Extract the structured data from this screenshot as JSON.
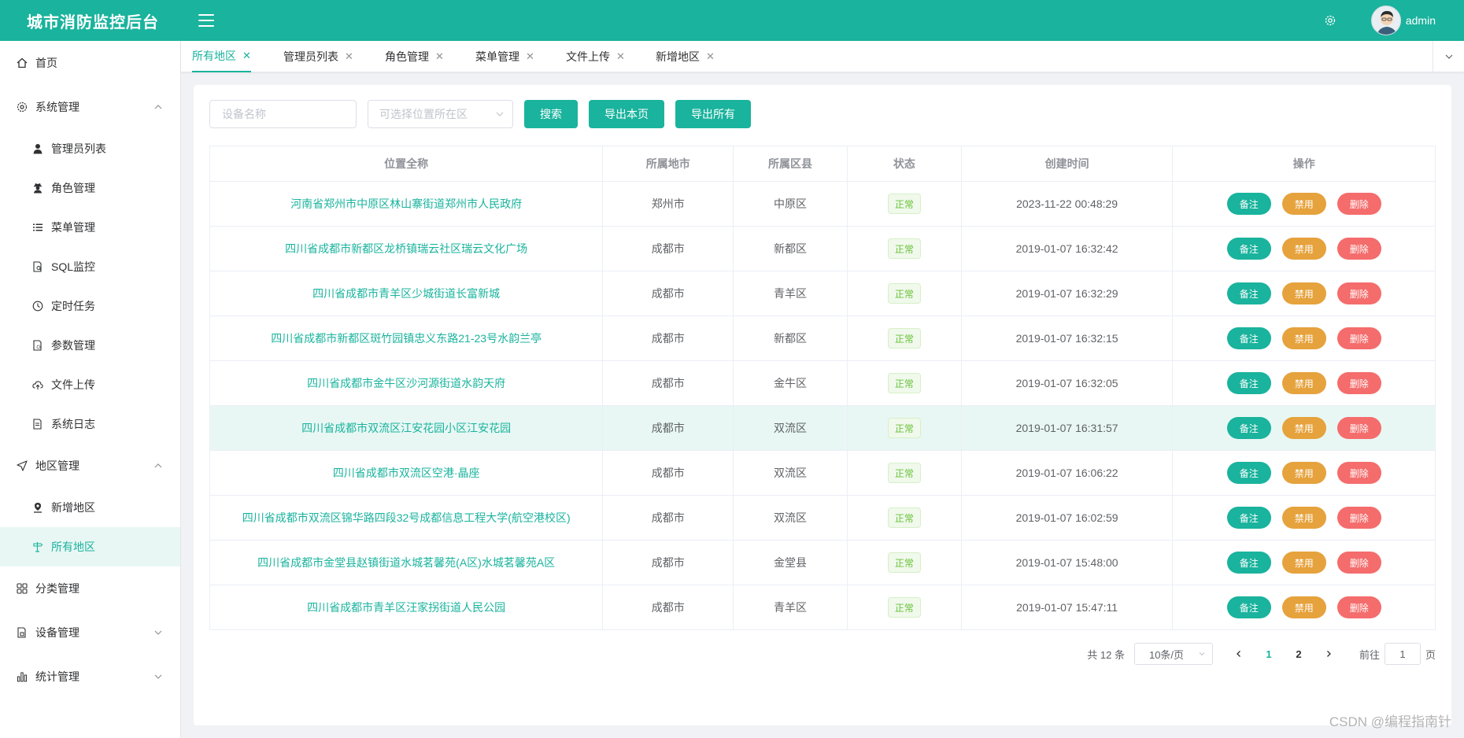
{
  "app": {
    "title": "城市消防监控后台",
    "user": "admin"
  },
  "colors": {
    "primary": "#1ab39d",
    "warning": "#e6a23c",
    "danger": "#f56c6c",
    "success_tag": "#67c23a"
  },
  "sidebar": {
    "home": "首页",
    "system": "系统管理",
    "system_items": [
      "管理员列表",
      "角色管理",
      "菜单管理",
      "SQL监控",
      "定时任务",
      "参数管理",
      "文件上传",
      "系统日志"
    ],
    "region": "地区管理",
    "region_items": [
      "新增地区",
      "所有地区"
    ],
    "category": "分类管理",
    "device": "设备管理",
    "stats": "统计管理"
  },
  "tabs": [
    "所有地区",
    "管理员列表",
    "角色管理",
    "菜单管理",
    "文件上传",
    "新增地区"
  ],
  "toolbar": {
    "device_placeholder": "设备名称",
    "district_placeholder": "可选择位置所在区",
    "search": "搜索",
    "export_page": "导出本页",
    "export_all": "导出所有"
  },
  "table": {
    "headers": [
      "位置全称",
      "所属地市",
      "所属区县",
      "状态",
      "创建时间",
      "操作"
    ],
    "actions": {
      "note": "备注",
      "ban": "禁用",
      "delete": "删除"
    },
    "rows": [
      {
        "location": "河南省郑州市中原区林山寨街道郑州市人民政府",
        "city": "郑州市",
        "district": "中原区",
        "status": "正常",
        "created": "2023-11-22 00:48:29"
      },
      {
        "location": "四川省成都市新都区龙桥镇瑞云社区瑞云文化广场",
        "city": "成都市",
        "district": "新都区",
        "status": "正常",
        "created": "2019-01-07 16:32:42"
      },
      {
        "location": "四川省成都市青羊区少城街道长富新城",
        "city": "成都市",
        "district": "青羊区",
        "status": "正常",
        "created": "2019-01-07 16:32:29"
      },
      {
        "location": "四川省成都市新都区斑竹园镇忠义东路21-23号水韵兰亭",
        "city": "成都市",
        "district": "新都区",
        "status": "正常",
        "created": "2019-01-07 16:32:15"
      },
      {
        "location": "四川省成都市金牛区沙河源街道水韵天府",
        "city": "成都市",
        "district": "金牛区",
        "status": "正常",
        "created": "2019-01-07 16:32:05"
      },
      {
        "location": "四川省成都市双流区江安花园小区江安花园",
        "city": "成都市",
        "district": "双流区",
        "status": "正常",
        "created": "2019-01-07 16:31:57"
      },
      {
        "location": "四川省成都市双流区空港·晶座",
        "city": "成都市",
        "district": "双流区",
        "status": "正常",
        "created": "2019-01-07 16:06:22"
      },
      {
        "location": "四川省成都市双流区锦华路四段32号成都信息工程大学(航空港校区)",
        "city": "成都市",
        "district": "双流区",
        "status": "正常",
        "created": "2019-01-07 16:02:59"
      },
      {
        "location": "四川省成都市金堂县赵镇街道水城茗馨苑(A区)水城茗馨苑A区",
        "city": "成都市",
        "district": "金堂县",
        "status": "正常",
        "created": "2019-01-07 15:48:00"
      },
      {
        "location": "四川省成都市青羊区汪家拐街道人民公园",
        "city": "成都市",
        "district": "青羊区",
        "status": "正常",
        "created": "2019-01-07 15:47:11"
      }
    ]
  },
  "pagination": {
    "total": "共 12 条",
    "page_size": "10条/页",
    "pages": [
      "1",
      "2"
    ],
    "current": "1",
    "goto_label": "前往",
    "goto_value": "1",
    "page_suffix": "页"
  },
  "watermark": "CSDN @编程指南针"
}
